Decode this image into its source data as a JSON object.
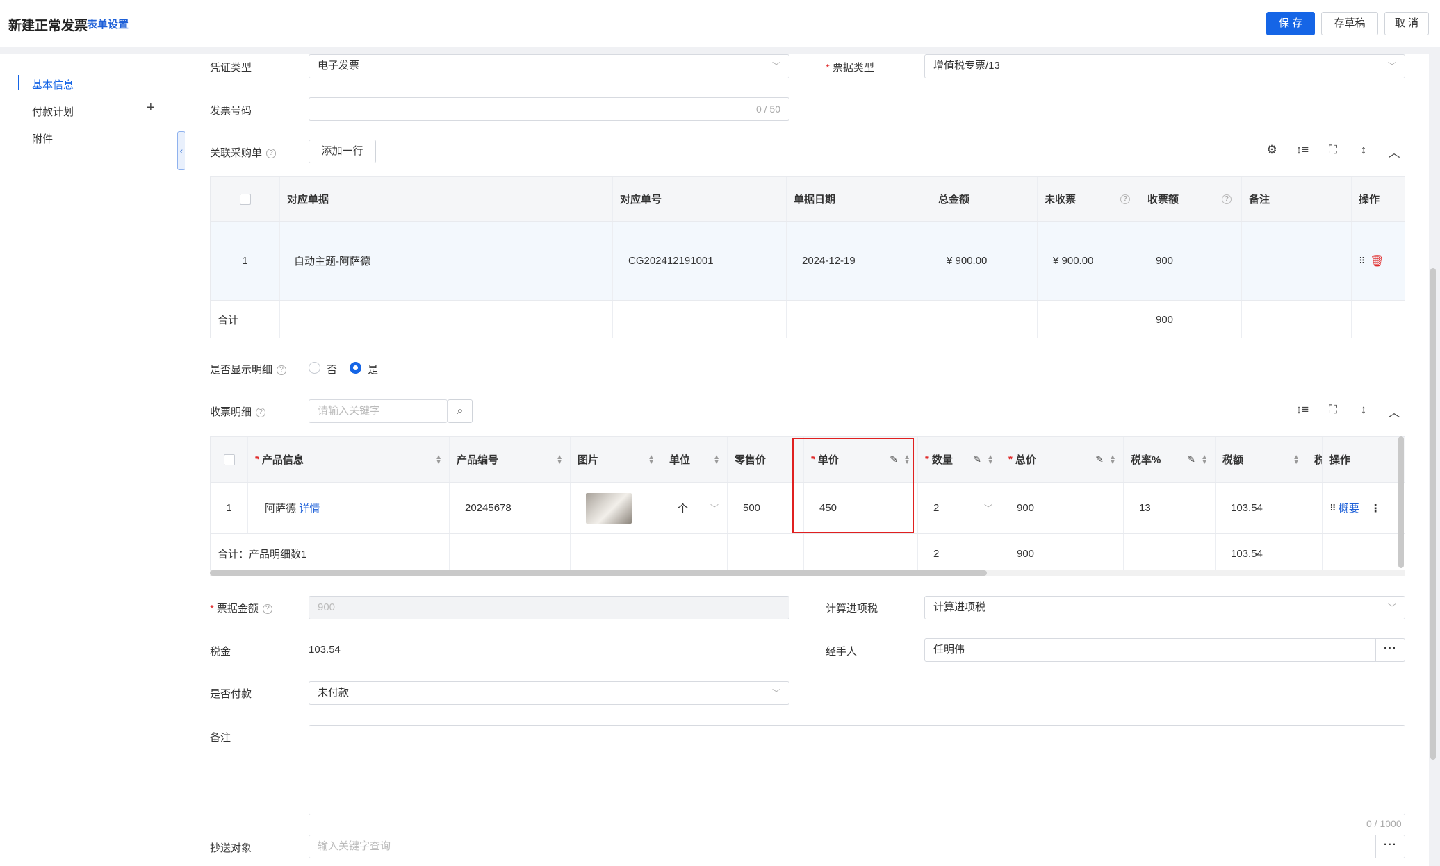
{
  "header": {
    "title": "新建正常发票",
    "form_settings": "表单设置",
    "save": "保 存",
    "draft": "存草稿",
    "cancel": "取 消"
  },
  "sidebar": {
    "items": [
      {
        "label": "基本信息"
      },
      {
        "label": "付款计划"
      },
      {
        "label": "附件"
      }
    ],
    "plus": "+"
  },
  "form": {
    "voucher_type": {
      "label": "凭证类型",
      "value": "电子发票"
    },
    "ticket_type": {
      "label": "票据类型",
      "value": "增值税专票/13"
    },
    "invoice_no": {
      "label": "发票号码",
      "value": "",
      "counter": "0 / 50"
    },
    "related_po": {
      "label": "关联采购单",
      "add_row": "添加一行"
    },
    "show_detail": {
      "label": "是否显示明细",
      "option_no": "否",
      "option_yes": "是",
      "selected": "是"
    },
    "receipt_detail": {
      "label": "收票明细",
      "placeholder": "请输入关键字"
    },
    "bill_amount": {
      "label": "票据金额",
      "value": "900"
    },
    "calc_tax": {
      "label": "计算进项税",
      "value": "计算进项税"
    },
    "tax": {
      "label": "税金",
      "value": "103.54"
    },
    "handler": {
      "label": "经手人",
      "value": "任明伟"
    },
    "paid": {
      "label": "是否付款",
      "value": "未付款"
    },
    "remark": {
      "label": "备注",
      "counter": "0 / 1000"
    },
    "cc": {
      "label": "抄送对象",
      "placeholder": "输入关键字查询"
    },
    "more": "···"
  },
  "po_table": {
    "headers": [
      "对应单据",
      "对应单号",
      "单据日期",
      "总金额",
      "未收票",
      "收票额",
      "备注",
      "操作"
    ],
    "rows": [
      {
        "index": "1",
        "doc": "自动主题-阿萨德",
        "no": "CG202412191001",
        "date": "2024-12-19",
        "total": "¥ 900.00",
        "unreceived": "¥ 900.00",
        "received": "900",
        "remark": ""
      }
    ],
    "summary": {
      "label": "合计",
      "received": "900"
    }
  },
  "detail_table": {
    "headers": [
      "产品信息",
      "产品编号",
      "图片",
      "单位",
      "零售价",
      "单价",
      "数量",
      "总价",
      "税率%",
      "税额",
      "税",
      "操作"
    ],
    "rows": [
      {
        "index": "1",
        "product": "阿萨德",
        "detail_link": "详情",
        "code": "20245678",
        "unit": "个",
        "retail": "500",
        "price": "450",
        "qty": "2",
        "total": "900",
        "rate": "13",
        "tax": "103.54",
        "overview": "概要"
      }
    ],
    "summary": {
      "label": "合计：产品明细数1",
      "qty": "2",
      "total": "900",
      "tax": "103.54"
    }
  }
}
